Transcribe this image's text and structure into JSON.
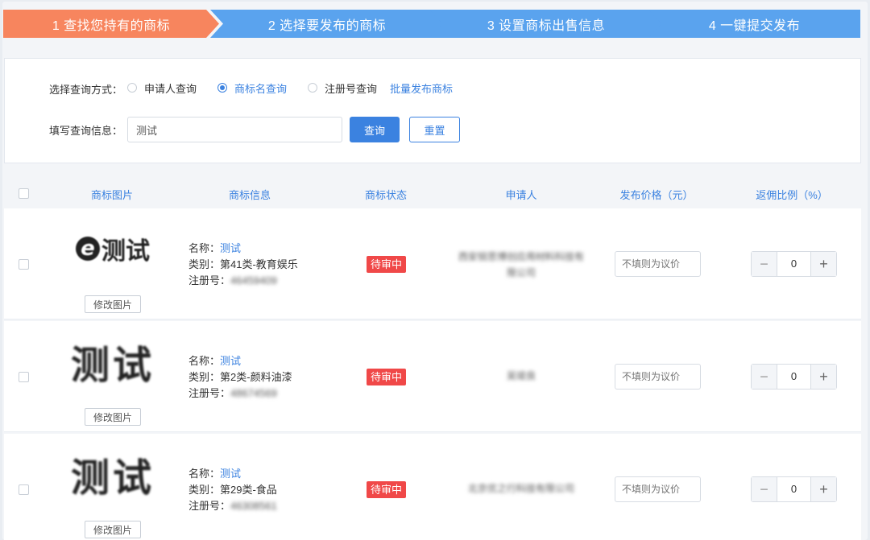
{
  "steps": [
    {
      "label": "1 查找您持有的商标"
    },
    {
      "label": "2 选择要发布的商标"
    },
    {
      "label": "3 设置商标出售信息"
    },
    {
      "label": "4 一键提交发布"
    }
  ],
  "query": {
    "method_label": "选择查询方式：",
    "options": [
      {
        "label": "申请人查询",
        "checked": false
      },
      {
        "label": "商标名查询",
        "checked": true
      },
      {
        "label": "注册号查询",
        "checked": false
      }
    ],
    "bulk_link": "批量发布商标",
    "info_label": "填写查询信息：",
    "input_value": "测试",
    "search_button": "查询",
    "reset_button": "重置"
  },
  "table": {
    "headers": [
      "商标图片",
      "商标信息",
      "商标状态",
      "申请人",
      "发布价格（元）",
      "返佣比例（%）"
    ],
    "name_prefix": "名称：",
    "category_prefix": "类别：",
    "reg_prefix": "注册号：",
    "edit_image_button": "修改图片",
    "price_placeholder": "不填则为议价",
    "rows": [
      {
        "logo": "测试",
        "name": "测试",
        "category": "第41类-教育娱乐",
        "reg_no": "46459409",
        "status": "待审中",
        "applicant": "西安锐思博创应用材料科技有限公司",
        "commission": "0"
      },
      {
        "logo": "测试",
        "name": "测试",
        "category": "第2类-颜料油漆",
        "reg_no": "48674569",
        "status": "待审中",
        "applicant": "吴竣良",
        "commission": "0"
      },
      {
        "logo": "测试",
        "name": "测试",
        "category": "第29类-食品",
        "reg_no": "46308561",
        "status": "待审中",
        "applicant": "北京优之行科技有限公司",
        "commission": "0"
      }
    ]
  },
  "colors": {
    "accent": "#3b82e0",
    "step_active": "#f7855e",
    "step_inactive": "#5aa3ee",
    "status_badge": "#f04848"
  }
}
